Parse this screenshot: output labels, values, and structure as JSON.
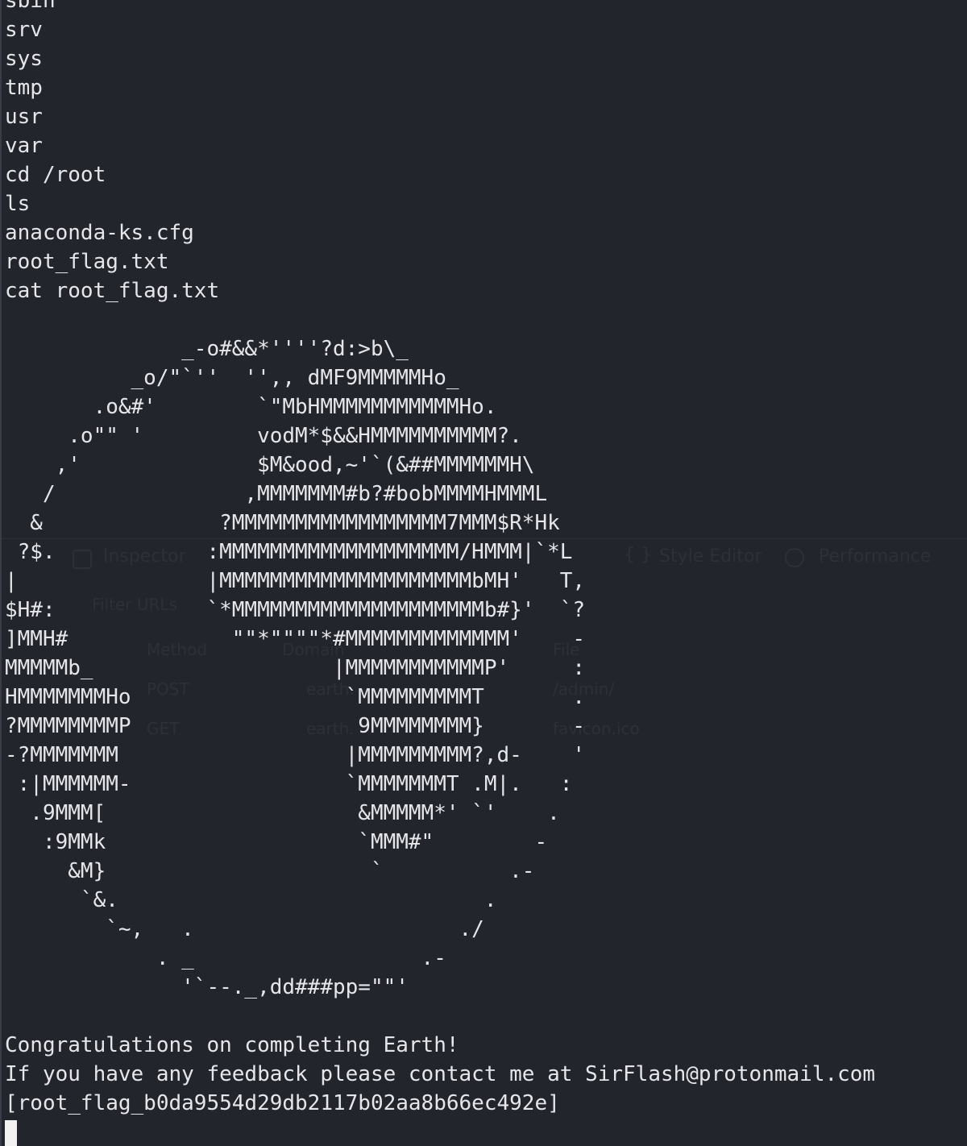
{
  "terminal": {
    "lines": [
      "sbin",
      "srv",
      "sys",
      "tmp",
      "usr",
      "var",
      "cd /root",
      "ls",
      "anaconda-ks.cfg",
      "root_flag.txt",
      "cat root_flag.txt",
      "",
      "              _-o#&&*''''?d:>b\\_",
      "          _o/\"`''  '',, dMF9MMMMMHo_",
      "       .o&#'        `\"MbHMMMMMMMMMMMHo.",
      "     .o\"\" '         vodM*$&&HMMMMMMMMMM?.",
      "    ,'              $M&ood,~'`(&##MMMMMMH\\",
      "   /               ,MMMMMMM#b?#bobMMMMHMMML",
      "  &              ?MMMMMMMMMMMMMMMMM7MMM$R*Hk",
      " ?$.            :MMMMMMMMMMMMMMMMMMM/HMMM|`*L",
      "|               |MMMMMMMMMMMMMMMMMMMMbMH'   T,",
      "$H#:            `*MMMMMMMMMMMMMMMMMMMMb#}'  `?",
      "]MMH#             \"\"*\"\"\"\"*#MMMMMMMMMMMMM'    -",
      "MMMMMb_                   |MMMMMMMMMMMP'     :",
      "HMMMMMMMHo                 `MMMMMMMMMT       .",
      "?MMMMMMMMP                  9MMMMMMMM}       -",
      "-?MMMMMMM                  |MMMMMMMMM?,d-    '",
      " :|MMMMMM-                 `MMMMMMMT .M|.   :",
      "  .9MMM[                    &MMMMM*' `'    .",
      "   :9MMk                    `MMM#\"        -",
      "     &M}                     `          .-",
      "      `&.                             .",
      "        `~,   .                     ./",
      "            . _                  .-",
      "              '`--._,dd###pp=\"\"'",
      "",
      "Congratulations on completing Earth!",
      "If you have any feedback please contact me at SirFlash@protonmail.com",
      "[root_flag_b0da9554d29db2117b02aa8b66ec492e]"
    ]
  },
  "ghost_overlay": {
    "tabs": [
      "Inspector",
      "Style Editor",
      "Performance"
    ],
    "filter_placeholder": "Filter URLs",
    "columns": [
      "Method",
      "Domain",
      "File"
    ],
    "rows": [
      {
        "method": "POST",
        "domain": "earth.",
        "file": "/admin/"
      },
      {
        "method": "GET",
        "domain": "earth.",
        "file": "favicon.ico"
      }
    ]
  }
}
